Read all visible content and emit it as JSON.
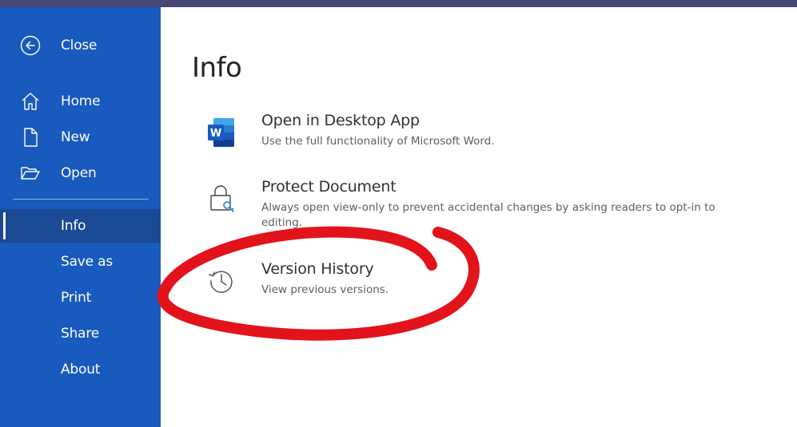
{
  "colors": {
    "sidebar_bg": "#185abd",
    "sidebar_active_bg": "#1a4a94",
    "top_strip": "#464775",
    "annotation": "#e3131b"
  },
  "sidebar": {
    "close": {
      "label": "Close",
      "icon": "back-arrow-icon"
    },
    "items": [
      {
        "label": "Home",
        "icon": "home-icon"
      },
      {
        "label": "New",
        "icon": "new-document-icon"
      },
      {
        "label": "Open",
        "icon": "folder-open-icon"
      },
      {
        "label": "Info",
        "active": true
      },
      {
        "label": "Save as"
      },
      {
        "label": "Print"
      },
      {
        "label": "Share"
      },
      {
        "label": "About"
      }
    ]
  },
  "main": {
    "title": "Info",
    "options": [
      {
        "title": "Open in Desktop App",
        "description": "Use the full functionality of Microsoft Word.",
        "icon": "word-app-icon"
      },
      {
        "title": "Protect Document",
        "description": "Always open view-only to prevent accidental changes by asking readers to opt-in to editing.",
        "icon": "lock-key-icon"
      },
      {
        "title": "Version History",
        "description": "View previous versions.",
        "icon": "history-clock-icon"
      }
    ]
  },
  "annotation": {
    "shape": "hand-drawn circle around Version History"
  }
}
